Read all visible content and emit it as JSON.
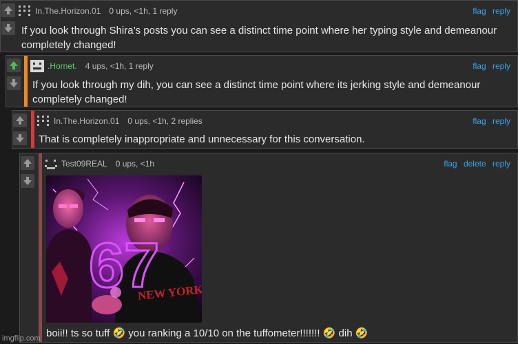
{
  "colors": {
    "accent_link": "#3aa2e6",
    "upvote_active": "#4bbf55",
    "bar_orange": "#f08a1f",
    "bar_red": "#d63a3a",
    "bar_brown": "#8a4a4a"
  },
  "comments": [
    {
      "username": "In.The.Horizon.01",
      "meta": "0 ups, <1h, 1 reply",
      "actions": [
        "flag",
        "reply"
      ],
      "text": "If you look through Shira’s posts you can see a distinct time point where her typing style and demeanour completely changed!"
    },
    {
      "username": ".Hornet.",
      "meta": "4 ups, <1h, 1 reply",
      "actions": [
        "flag",
        "reply"
      ],
      "text": "If you look through my dih, you can see a distinct time point where its jerking style and demeanour completely changed!",
      "upvoted": true
    },
    {
      "username": "In.The.Horizon.01",
      "meta": "0 ups, <1h, 2 replies",
      "actions": [
        "flag",
        "reply"
      ],
      "text": "That is completely inappropriate and unnecessary for this conversation."
    },
    {
      "username": "Test09REAL",
      "meta": "0 ups, <1h",
      "actions": [
        "flag",
        "delete",
        "reply"
      ],
      "text": "boii!! ts so tuff 🤣 you ranking a 10/10 on the tuffometer!!!!!!! 🤣 dih 🤣",
      "image_text": {
        "number": "67",
        "shirt": "NEW YORK"
      }
    }
  ],
  "watermark": "imgflip.com"
}
